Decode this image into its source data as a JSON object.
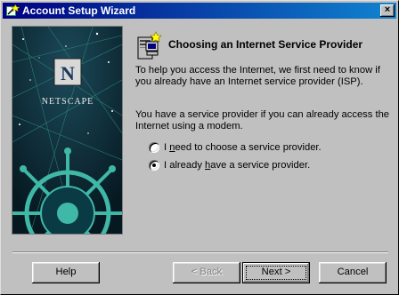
{
  "window": {
    "title": "Account Setup Wizard",
    "close_glyph": "×"
  },
  "sidebar_art": {
    "brand": "NETSCAPE",
    "logo_letter": "N"
  },
  "content": {
    "heading": "Choosing an Internet Service Provider",
    "paragraph1": "To help you access the Internet, we first need to know if you already have an Internet service provider (ISP).",
    "paragraph2": "You have a service provider if you can already access the Internet using a modem.",
    "options": [
      {
        "pre": "I ",
        "accel": "n",
        "post": "eed to choose a service provider.",
        "selected": false
      },
      {
        "pre": "I already ",
        "accel": "h",
        "post": "ave a service provider.",
        "selected": true
      }
    ]
  },
  "buttons": {
    "help": "Help",
    "back": "< Back",
    "next": "Next >",
    "cancel": "Cancel"
  },
  "colors": {
    "titlebar_start": "#000080",
    "titlebar_end": "#1084d0",
    "face": "#c0c0c0",
    "art_background": "#0a2a3a",
    "art_accent": "#2fa89a"
  }
}
